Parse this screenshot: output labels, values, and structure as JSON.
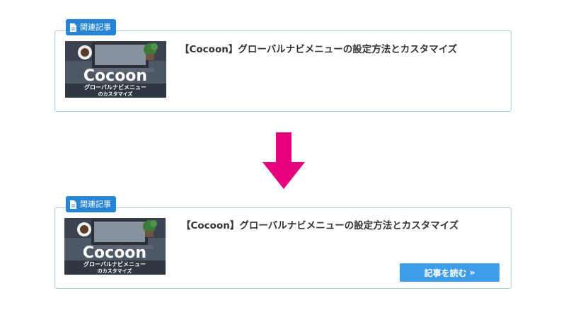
{
  "before": {
    "badge_label": "関連記事",
    "article_title": "【Cocoon】グローバルナビメニューの設定方法とカスタマイズ",
    "thumbnail": {
      "brand": "Cocoon",
      "line1": "グローバルナビメニュー",
      "line2": "のカスタマイズ"
    }
  },
  "after": {
    "badge_label": "関連記事",
    "article_title": "【Cocoon】グローバルナビメニューの設定方法とカスタマイズ",
    "thumbnail": {
      "brand": "Cocoon",
      "line1": "グローバルナビメニュー",
      "line2": "のカスタマイズ"
    },
    "read_more_label": "記事を読む",
    "read_more_icon": "»"
  },
  "icons": {
    "badge": "document-icon",
    "transition": "arrow-down-icon"
  },
  "colors": {
    "badge": "#2684d5",
    "card_border": "#aacde8",
    "button": "#3f9ce8",
    "arrow": "#e6007e"
  }
}
